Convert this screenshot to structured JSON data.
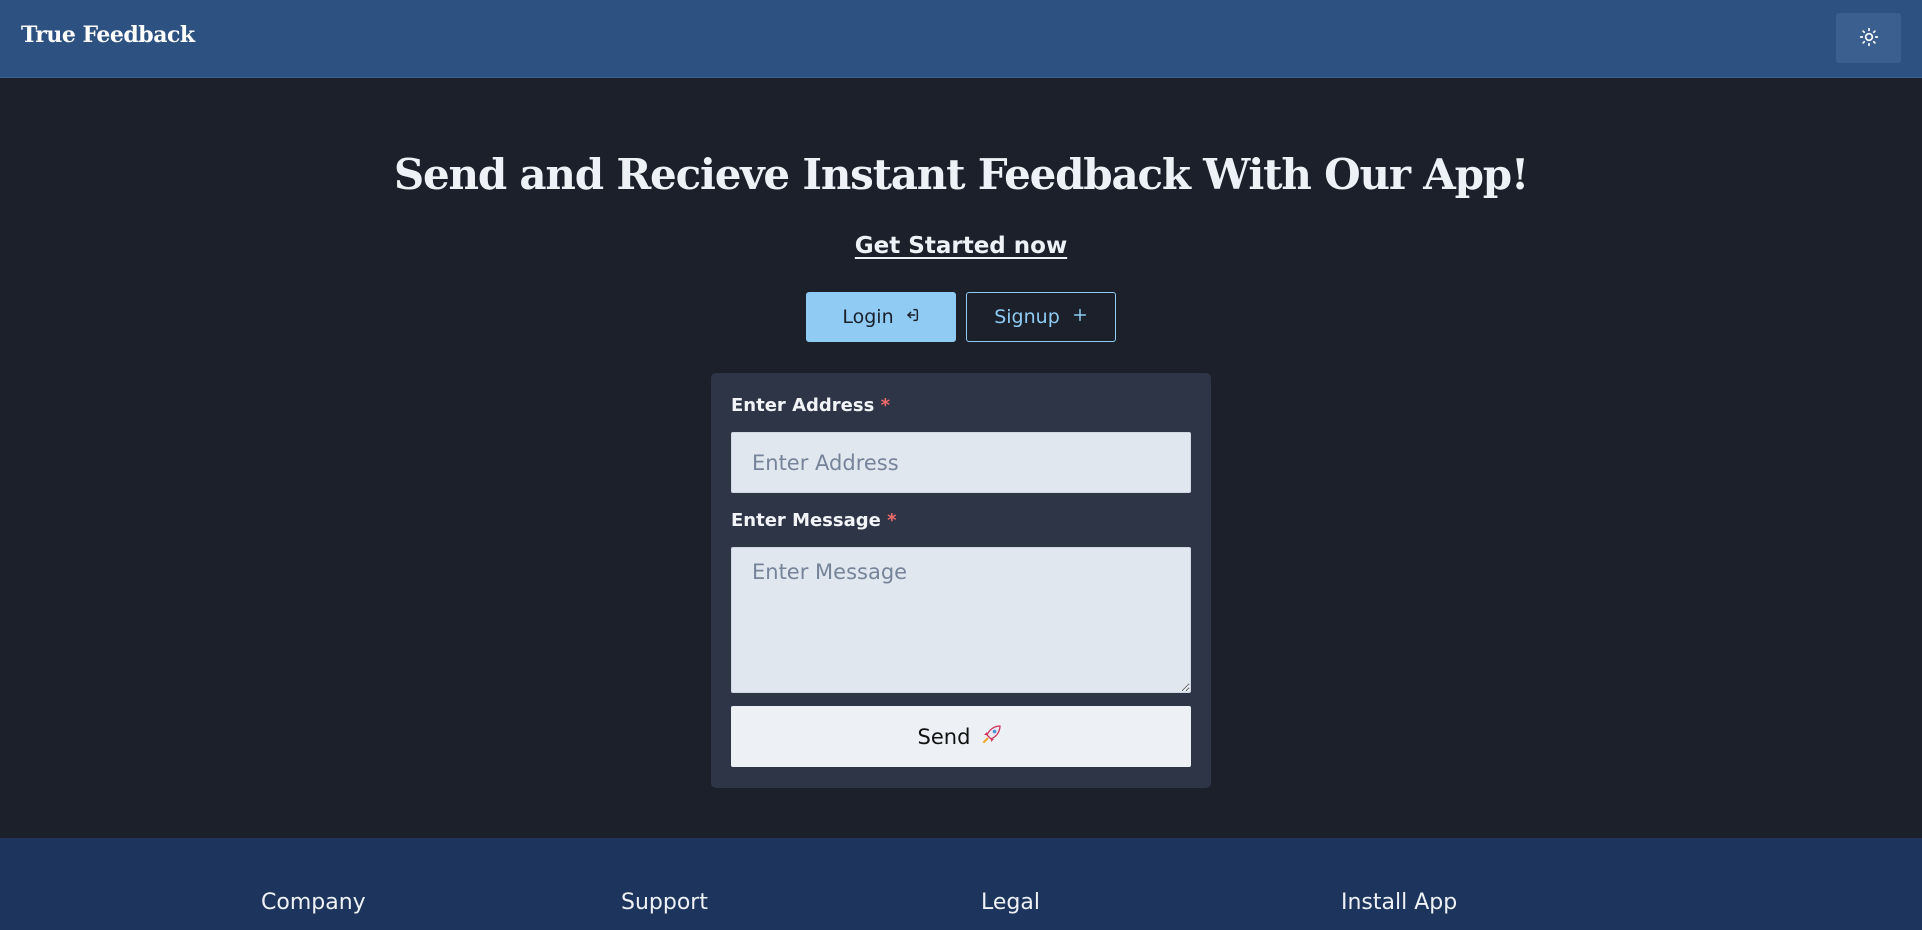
{
  "navbar": {
    "brand": "True Feedback",
    "theme_toggle_icon": "sun-icon"
  },
  "hero": {
    "title": "Send and Recieve Instant Feedback With Our App!",
    "cta": "Get Started now"
  },
  "auth": {
    "login_label": "Login",
    "login_icon": "login-arrow-icon",
    "signup_label": "Signup",
    "signup_icon": "plus-icon"
  },
  "form": {
    "address_label": "Enter Address",
    "address_placeholder": "Enter Address",
    "address_value": "",
    "message_label": "Enter Message",
    "message_placeholder": "Enter Message",
    "message_value": "",
    "required_mark": "*",
    "send_label": "Send",
    "send_icon": "rocket-icon"
  },
  "footer": {
    "columns": [
      "Company",
      "Support",
      "Legal",
      "Install App"
    ]
  },
  "colors": {
    "navbar_bg": "#2d5181",
    "page_bg": "#1b202b",
    "card_bg": "#2d3546",
    "accent": "#8fcbf3",
    "footer_bg": "#1d355c",
    "required": "#f26b6b"
  }
}
